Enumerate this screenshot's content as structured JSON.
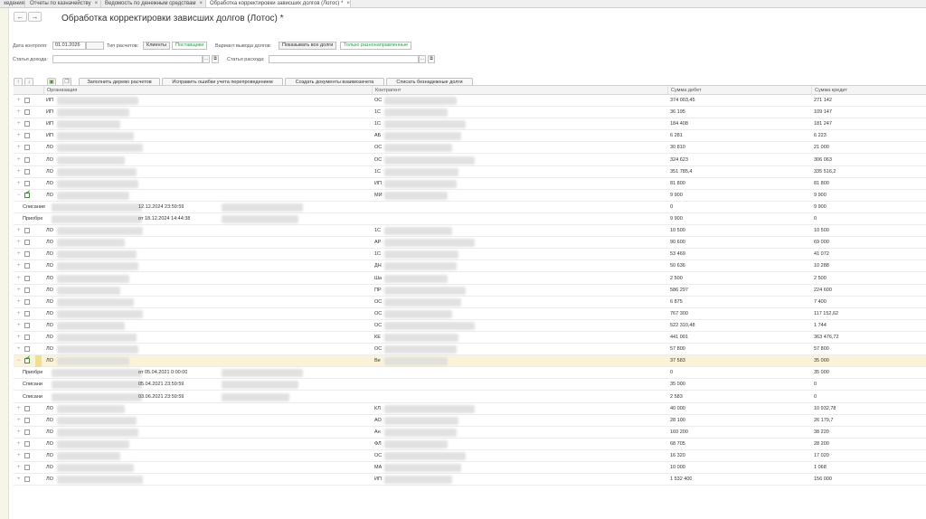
{
  "tabs": [
    {
      "label": "хедения",
      "close": ""
    },
    {
      "label": "Отчеты по казначейству",
      "close": "×"
    },
    {
      "label": "Ведомость по денежным средствам",
      "close": "×"
    },
    {
      "label": "Обработка корректировки зависших долгов (Лотос) *",
      "close": "×"
    }
  ],
  "nav": {
    "back": "←",
    "forward": "→"
  },
  "page_title": "Обработка корректировки зависших долгов (Лотос) *",
  "filters": {
    "date_label": "Дата контроля:",
    "date_value": "01.01.2026",
    "calc_type_label": "Тип расчетов:",
    "calc_type_options": [
      "Клиенты",
      "Поставщики"
    ],
    "output_label": "Вариант вывода долгов:",
    "output_options": [
      "Показывать все долги",
      "Только разнонаправленные"
    ],
    "income_label": "Статья дохода:",
    "income_value": "",
    "expense_label": "Статья расхода:",
    "expense_value": "",
    "select_btn": "...",
    "open_btn": "⧉"
  },
  "toolbar": {
    "up": "↑",
    "down": "↓",
    "fill": "Заполнить дерево расчетов",
    "fix": "Исправить ошибки учета перепроведением",
    "create": "Создать документы взаимозачета",
    "writeoff": "Списать безнадежные долги"
  },
  "columns": [
    "Организация",
    "Контрагент",
    "Сумма дебет",
    "Сумма кредит"
  ],
  "rows": [
    {
      "exp": "+",
      "check": false,
      "org": "ИП",
      "contr": "ОС",
      "debit": "374 003,45",
      "credit": "271 142"
    },
    {
      "exp": "+",
      "check": false,
      "org": "ИП",
      "contr": "1С",
      "debit": "36 195",
      "credit": "109 147"
    },
    {
      "exp": "+",
      "check": false,
      "org": "ИП",
      "contr": "1С",
      "debit": "184 408",
      "credit": "181 247"
    },
    {
      "exp": "+",
      "check": false,
      "org": "ИП",
      "contr": "АБ",
      "debit": "6 281",
      "credit": "6 223"
    },
    {
      "exp": "+",
      "check": false,
      "org": "ЛО",
      "contr": "ОС",
      "debit": "30 810",
      "credit": "21 000"
    },
    {
      "exp": "+",
      "check": false,
      "org": "ЛО",
      "contr": "ОС",
      "debit": "324 623",
      "credit": "306 063"
    },
    {
      "exp": "+",
      "check": false,
      "org": "ЛО",
      "contr": "1С",
      "debit": "351 785,4",
      "credit": "335 516,2"
    },
    {
      "exp": "+",
      "check": false,
      "org": "ЛО",
      "contr": "ИП",
      "debit": "81 800",
      "credit": "81 800"
    },
    {
      "exp": "−",
      "check": true,
      "org": "ЛО",
      "contr": "МИ",
      "debit": "9 900",
      "credit": "9 900"
    },
    {
      "child": true,
      "doc": "Списание",
      "doc2": "12.12.2024 23:59:59",
      "debit": "0",
      "credit": "9 900"
    },
    {
      "child": true,
      "doc": "Приобре",
      "doc2": "от 18.12.2024 14:44:38",
      "debit": "9 900",
      "credit": "0"
    },
    {
      "exp": "+",
      "check": false,
      "org": "ЛО",
      "contr": "1С",
      "debit": "10 500",
      "credit": "10 500"
    },
    {
      "exp": "+",
      "check": false,
      "org": "ЛО",
      "contr": "АР",
      "debit": "90 600",
      "credit": "69 000"
    },
    {
      "exp": "+",
      "check": false,
      "org": "ЛО",
      "contr": "1С",
      "debit": "53 469",
      "credit": "41 072"
    },
    {
      "exp": "+",
      "check": false,
      "org": "ЛО",
      "contr": "ДН",
      "debit": "50 636",
      "credit": "10 288"
    },
    {
      "exp": "+",
      "check": false,
      "org": "ЛО",
      "contr": "Ша",
      "debit": "2 500",
      "credit": "2 500"
    },
    {
      "exp": "+",
      "check": false,
      "org": "ЛО",
      "contr": "ПР",
      "debit": "586 297",
      "credit": "224 600"
    },
    {
      "exp": "+",
      "check": false,
      "org": "ЛО",
      "contr": "ОС",
      "debit": "6 875",
      "credit": "7 400"
    },
    {
      "exp": "+",
      "check": false,
      "org": "ЛО",
      "contr": "ОС",
      "debit": "767 300",
      "credit": "117 152,62"
    },
    {
      "exp": "+",
      "check": false,
      "org": "ЛО",
      "contr": "ОС",
      "debit": "522 310,48",
      "credit": "1 744"
    },
    {
      "exp": "+",
      "check": false,
      "org": "ЛО",
      "contr": "КЕ",
      "debit": "441 001",
      "credit": "363 476,72"
    },
    {
      "exp": "+",
      "check": false,
      "org": "ЛО",
      "contr": "ОС",
      "debit": "57 800",
      "credit": "57 800"
    },
    {
      "exp": "−",
      "check": true,
      "hl": true,
      "org": "ЛО",
      "contr": "Ве",
      "debit": "37 583",
      "credit": "35 000"
    },
    {
      "child": true,
      "doc": "Приобре",
      "doc2": "от 05.04.2021 0:00:00",
      "debit": "0",
      "credit": "35 000"
    },
    {
      "child": true,
      "doc": "Списани",
      "doc2": "05.04.2021 23:59:59",
      "debit": "35 000",
      "credit": "0"
    },
    {
      "child": true,
      "doc": "Списани",
      "doc2": "03.06.2021 23:59:59",
      "debit": "2 583",
      "credit": "0"
    },
    {
      "exp": "+",
      "check": false,
      "org": "ЛО",
      "contr": "КЛ",
      "debit": "40 000",
      "credit": "10 932,78"
    },
    {
      "exp": "+",
      "check": false,
      "org": "ЛО",
      "contr": "АО",
      "debit": "28 100",
      "credit": "26 179,7"
    },
    {
      "exp": "+",
      "check": false,
      "org": "ЛО",
      "contr": "Ан",
      "debit": "160 200",
      "credit": "38 220"
    },
    {
      "exp": "+",
      "check": false,
      "org": "ЛО",
      "contr": "ФЛ",
      "debit": "68 705",
      "credit": "28 200"
    },
    {
      "exp": "+",
      "check": false,
      "org": "ЛО",
      "contr": "ОС",
      "debit": "16 320",
      "credit": "17 020"
    },
    {
      "exp": "+",
      "check": false,
      "org": "ЛО",
      "contr": "МА",
      "debit": "10 000",
      "credit": "1 068"
    },
    {
      "exp": "+",
      "check": false,
      "org": "ЛО",
      "contr": "ИП",
      "debit": "1 532 400",
      "credit": "156 000"
    }
  ],
  "colors": {
    "accent_green": "#2a9d4b",
    "highlight_row": "#fbf3d9",
    "marker": "#f2df8a"
  }
}
